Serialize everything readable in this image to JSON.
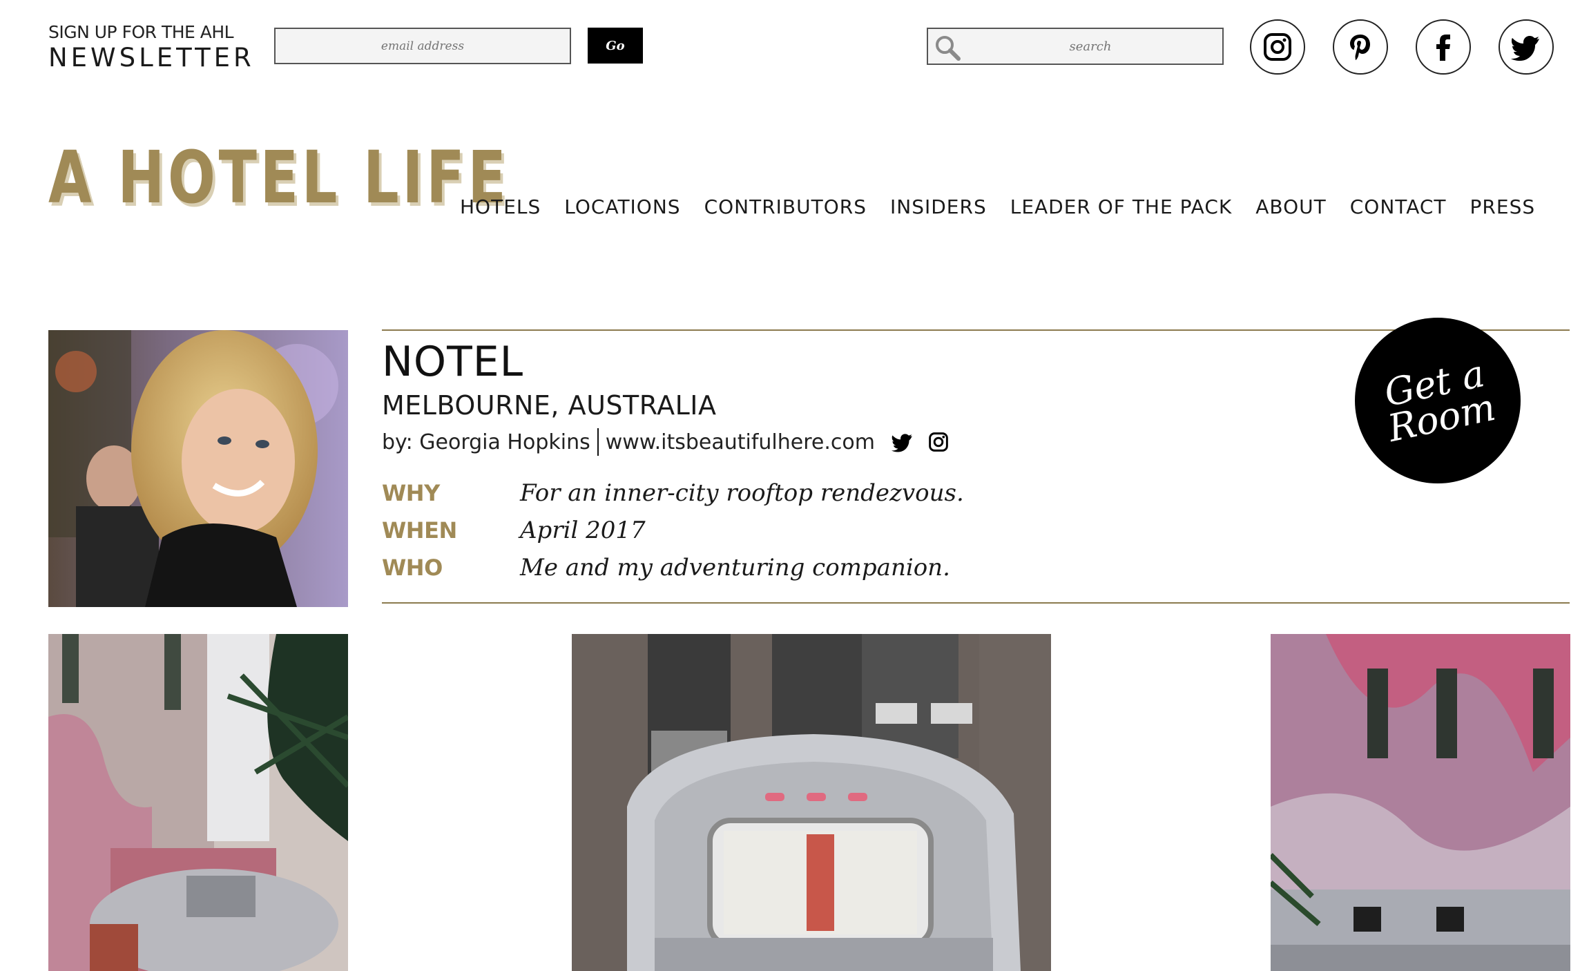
{
  "newsletter": {
    "line1": "SIGN UP FOR THE AHL",
    "line2": "NEWSLETTER"
  },
  "email": {
    "placeholder": "email address",
    "go_label": "Go"
  },
  "search": {
    "placeholder": "search"
  },
  "social": [
    {
      "name": "instagram-icon"
    },
    {
      "name": "pinterest-icon"
    },
    {
      "name": "facebook-icon"
    },
    {
      "name": "twitter-icon"
    }
  ],
  "logo": "A HOTEL LIFE",
  "nav": [
    "HOTELS",
    "LOCATIONS",
    "CONTRIBUTORS",
    "INSIDERS",
    "LEADER OF THE PACK",
    "ABOUT",
    "CONTACT",
    "PRESS"
  ],
  "hotel": {
    "name": "NOTEL",
    "location": "MELBOURNE, AUSTRALIA",
    "by": "by: Georgia Hopkins",
    "website": "www.itsbeautifulhere.com"
  },
  "info": [
    {
      "key": "WHY",
      "value": "For an inner-city rooftop rendezvous."
    },
    {
      "key": "WHEN",
      "value": "April 2017"
    },
    {
      "key": "WHO",
      "value": "Me and my adventuring companion."
    }
  ],
  "badge": {
    "line1": "Get a",
    "line2": "Room"
  },
  "colors": {
    "accent": "#a08a56",
    "rule": "#8b7a4e",
    "badge": "#000000"
  }
}
